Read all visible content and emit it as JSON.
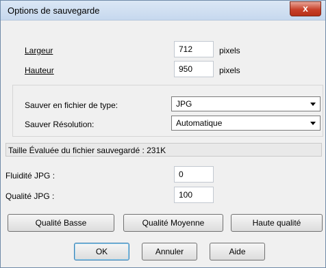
{
  "window": {
    "title": "Options de sauvegarde",
    "close_glyph": "x"
  },
  "size": {
    "width_label": "Largeur",
    "width_value": "712",
    "width_unit": "pixels",
    "height_label": "Hauteur",
    "height_value": "950",
    "height_unit": "pixels"
  },
  "save_type": {
    "label": "Sauver en fichier de type:",
    "value": "JPG"
  },
  "save_resolution": {
    "label": "Sauver Résolution:",
    "value": "Automatique"
  },
  "status_text": "Taille Évaluée du fichier sauvegardé : 231K",
  "jpg_smoothing": {
    "label": "Fluidité JPG :",
    "value": "0"
  },
  "jpg_quality": {
    "label": "Qualité JPG :",
    "value": "100"
  },
  "preset_buttons": {
    "low": "Qualité Basse",
    "medium": "Qualité Moyenne",
    "high": "Haute qualité"
  },
  "dialog_buttons": {
    "ok": "OK",
    "cancel": "Annuler",
    "help": "Aide"
  }
}
